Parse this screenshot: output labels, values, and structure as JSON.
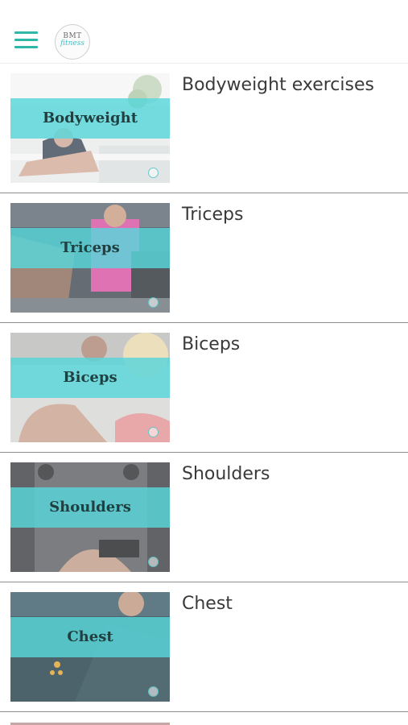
{
  "header": {
    "menu_icon": "hamburger-menu-icon",
    "logo": {
      "line1": "BMT",
      "line2": "fitness"
    },
    "accent_color": "#2fb8a8"
  },
  "categories": [
    {
      "title": "Bodyweight exercises",
      "thumb_label": "Bodyweight"
    },
    {
      "title": "Triceps",
      "thumb_label": "Triceps"
    },
    {
      "title": "Biceps",
      "thumb_label": "Biceps"
    },
    {
      "title": "Shoulders",
      "thumb_label": "Shoulders"
    },
    {
      "title": "Chest",
      "thumb_label": "Chest"
    }
  ],
  "band_color": "#58d7da"
}
